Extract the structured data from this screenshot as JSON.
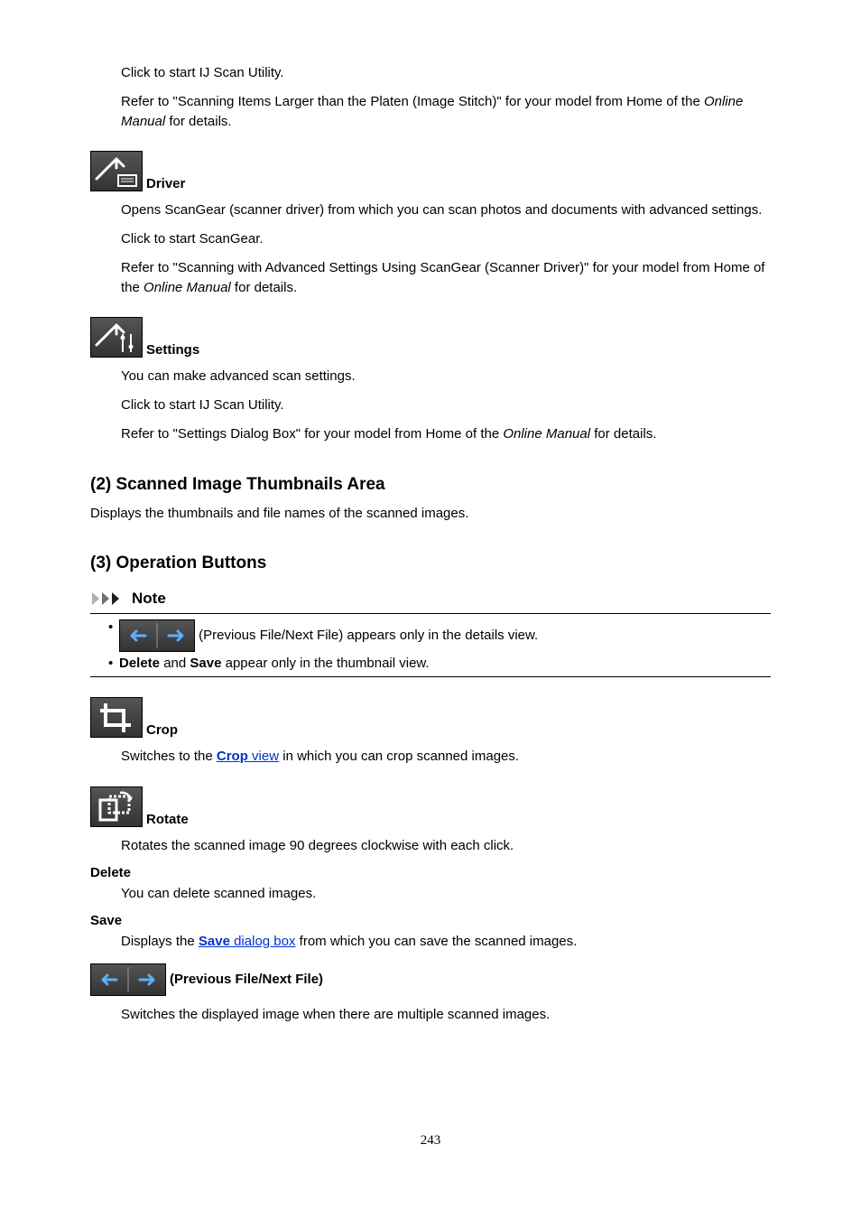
{
  "intro": {
    "p1": "Click to start IJ Scan Utility.",
    "p2a": "Refer to \"Scanning Items Larger than the Platen (Image Stitch)\" for your model from Home of the ",
    "p2b": "Online Manual",
    "p2c": " for details."
  },
  "driver": {
    "label": "Driver",
    "p1": "Opens ScanGear (scanner driver) from which you can scan photos and documents with advanced settings.",
    "p2": "Click to start ScanGear.",
    "p3a": "Refer to \"Scanning with Advanced Settings Using ScanGear (Scanner Driver)\" for your model from Home of the ",
    "p3b": "Online Manual",
    "p3c": " for details."
  },
  "settings": {
    "label": "Settings",
    "p1": "You can make advanced scan settings.",
    "p2": "Click to start IJ Scan Utility.",
    "p3a": "Refer to \"Settings Dialog Box\" for your model from Home of the ",
    "p3b": "Online Manual",
    "p3c": " for details."
  },
  "sec2": {
    "heading": "(2) Scanned Image Thumbnails Area",
    "p1": "Displays the thumbnails and file names of the scanned images."
  },
  "sec3": {
    "heading": "(3) Operation Buttons",
    "note_label": "Note",
    "note1": " (Previous File/Next File) appears only in the details view.",
    "note2a": "Delete",
    "note2b": " and ",
    "note2c": "Save",
    "note2d": " appear only in the thumbnail view."
  },
  "crop": {
    "label": "Crop",
    "p1a": "Switches to the ",
    "link1a": "Crop",
    "link1b": " view",
    "p1c": " in which you can crop scanned images."
  },
  "rotate": {
    "label": "Rotate",
    "p1": "Rotates the scanned image 90 degrees clockwise with each click."
  },
  "delete": {
    "label": "Delete",
    "p1": "You can delete scanned images."
  },
  "save": {
    "label": "Save",
    "p1a": "Displays the ",
    "link1a": "Save",
    "link1b": " dialog box",
    "p1c": " from which you can save the scanned images."
  },
  "prevnext": {
    "label": "(Previous File/Next File)",
    "p1": "Switches the displayed image when there are multiple scanned images."
  },
  "page_number": "243"
}
